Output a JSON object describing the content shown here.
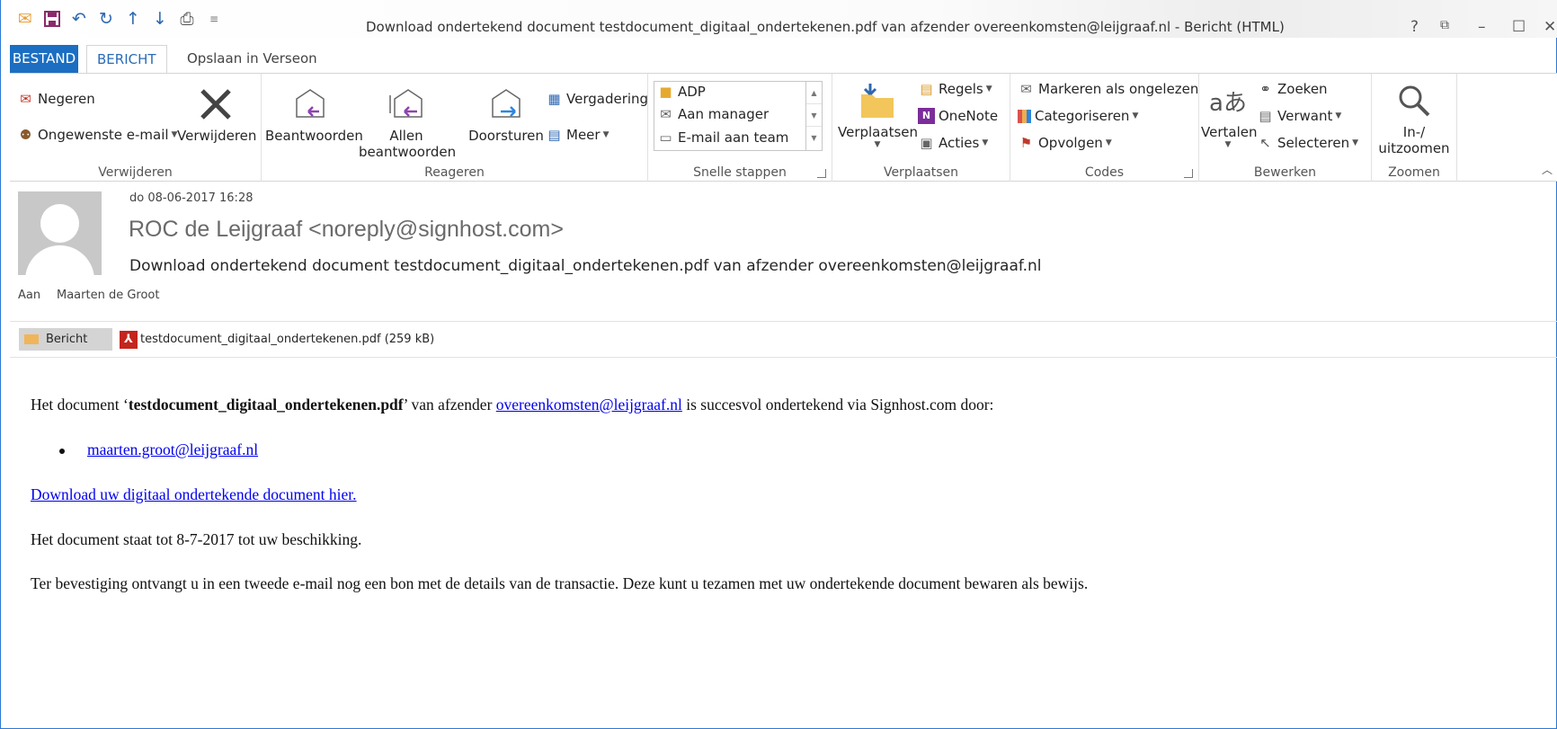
{
  "window": {
    "title": "Download ondertekend document testdocument_digitaal_ondertekenen.pdf van afzender overeenkomsten@leijgraaf.nl - Bericht (HTML)",
    "controls": [
      "?",
      "⧉",
      "–",
      "☐",
      "✕"
    ]
  },
  "tabs": {
    "file": "BESTAND",
    "message": "BERICHT",
    "save": "Opslaan in Verseon"
  },
  "ribbon": {
    "delete_group": {
      "label": "Verwijderen",
      "ignore": "Negeren",
      "junk": "Ongewenste e-mail",
      "delete": "Verwijderen"
    },
    "respond_group": {
      "label": "Reageren",
      "reply": "Beantwoorden",
      "reply_all_1": "Allen",
      "reply_all_2": "beantwoorden",
      "forward": "Doorsturen",
      "meeting": "Vergadering",
      "more": "Meer"
    },
    "quick_steps": {
      "label": "Snelle stappen",
      "items": [
        "ADP",
        "Aan manager",
        "E-mail aan team"
      ]
    },
    "move_group": {
      "label": "Verplaatsen",
      "move": "Verplaatsen",
      "rules": "Regels",
      "onenote": "OneNote",
      "actions": "Acties"
    },
    "tags_group": {
      "label": "Codes",
      "mark_unread": "Markeren als ongelezen",
      "categorize": "Categoriseren",
      "follow_up": "Opvolgen"
    },
    "edit_group": {
      "label": "Bewerken",
      "translate": "Vertalen",
      "find": "Zoeken",
      "related": "Verwant",
      "select": "Selecteren"
    },
    "zoom_group": {
      "label": "Zoomen",
      "zoom_1": "In-/",
      "zoom_2": "uitzoomen"
    }
  },
  "message": {
    "date": "do 08-06-2017 16:28",
    "from": "ROC de Leijgraaf <noreply@signhost.com>",
    "subject": "Download ondertekend document testdocument_digitaal_ondertekenen.pdf van afzender overeenkomsten@leijgraaf.nl",
    "to_label": "Aan",
    "to_name": "Maarten de Groot",
    "attachments": {
      "message_tab": "Bericht",
      "file": "testdocument_digitaal_ondertekenen.pdf (259 kB)"
    }
  },
  "body": {
    "p1_a": "Het document ‘",
    "p1_doc": "testdocument_digitaal_ondertekenen.pdf",
    "p1_b": "’ van afzender ",
    "p1_link": "overeenkomsten@leijgraaf.nl",
    "p1_c": " is succesvol ondertekend via Signhost.com door:",
    "signer": "maarten.groot@leijgraaf.nl",
    "download_link": "Download uw digitaal ondertekende document hier.",
    "availability": "Het document staat tot 8-7-2017 tot uw beschikking.",
    "confirmation": "Ter bevestiging ontvangt u in een tweede e-mail nog een bon met de details van de transactie. Deze kunt u tezamen met uw ondertekende document bewaren als bewijs."
  }
}
